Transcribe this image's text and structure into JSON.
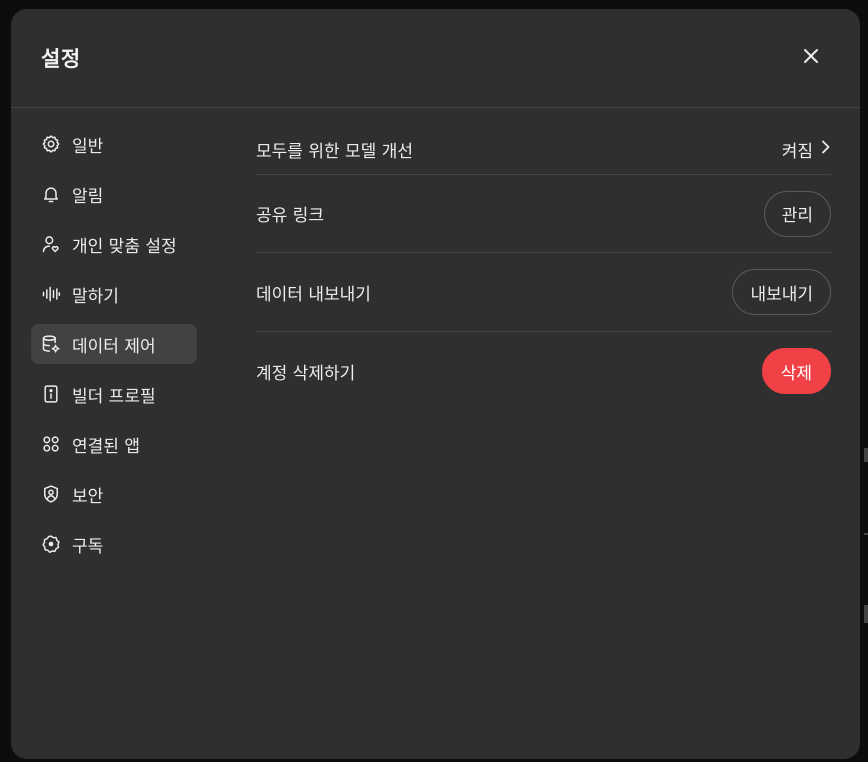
{
  "dialog": {
    "title": "설정",
    "close_icon": "close-icon"
  },
  "sidebar": {
    "items": [
      {
        "label": "일반",
        "icon": "gear-icon"
      },
      {
        "label": "알림",
        "icon": "bell-icon"
      },
      {
        "label": "개인 맞춤 설정",
        "icon": "person-heart-icon"
      },
      {
        "label": "말하기",
        "icon": "waveform-icon"
      },
      {
        "label": "데이터 제어",
        "icon": "database-settings-icon",
        "active": true
      },
      {
        "label": "빌더 프로필",
        "icon": "id-card-icon"
      },
      {
        "label": "연결된 앱",
        "icon": "apps-grid-icon"
      },
      {
        "label": "보안",
        "icon": "shield-icon"
      },
      {
        "label": "구독",
        "icon": "badge-icon"
      }
    ]
  },
  "content": {
    "rows": [
      {
        "label": "모두를 위한 모델 개선",
        "value": "켜짐"
      },
      {
        "label": "공유 링크",
        "button": "관리"
      },
      {
        "label": "데이터 내보내기",
        "button": "내보내기"
      },
      {
        "label": "계정 삭제하기",
        "button": "삭제"
      }
    ]
  },
  "colors": {
    "modal_bg": "#2f2f2f",
    "active_bg": "#424242",
    "danger": "#ef4146"
  }
}
